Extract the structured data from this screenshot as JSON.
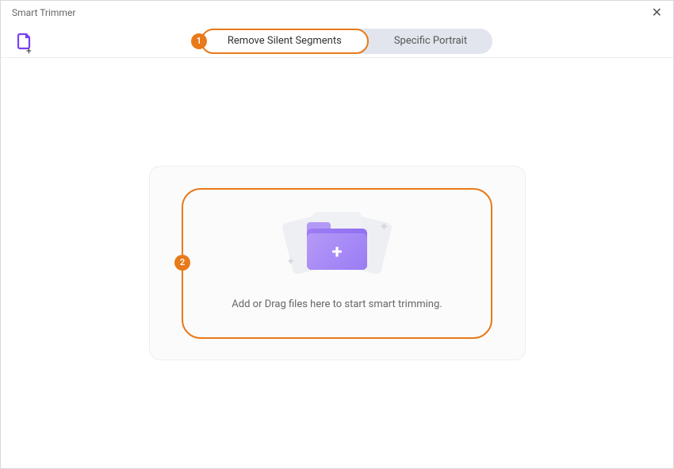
{
  "window": {
    "title": "Smart Trimmer"
  },
  "tabs": {
    "remove_silent": "Remove Silent Segments",
    "specific_portrait": "Specific Portrait"
  },
  "steps": {
    "one": "1",
    "two": "2"
  },
  "dropzone": {
    "text": "Add or Drag files here to start smart trimming."
  },
  "icons": {
    "close": "✕",
    "folder_plus": "+",
    "sparkle": "✦"
  },
  "colors": {
    "accent_orange": "#e87a1a",
    "accent_purple": "#9a7cf4"
  }
}
